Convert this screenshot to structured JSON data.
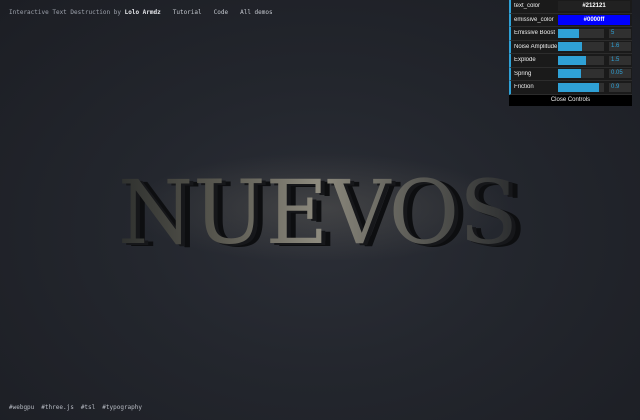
{
  "header": {
    "credit_prefix": "Interactive Text Destruction by",
    "credit_author": "Lolo Armdz",
    "links": [
      "Tutorial",
      "Code",
      "All demos"
    ]
  },
  "hero": {
    "text": "NUEVOS"
  },
  "footer": {
    "tags": [
      "#webgpu",
      "#three.js",
      "#tsl",
      "#typography"
    ]
  },
  "controls": {
    "text_color": {
      "label": "text_color",
      "value": "#212121"
    },
    "emissive_color": {
      "label": "emissive_color",
      "value": "#0000ff"
    },
    "sliders": [
      {
        "label": "Emissive Boost",
        "value": "5",
        "fill": 0.45
      },
      {
        "label": "Noise Amplitude",
        "value": "1.6",
        "fill": 0.53
      },
      {
        "label": "Explode",
        "value": "1.5",
        "fill": 0.6
      },
      {
        "label": "Spring",
        "value": "0.05",
        "fill": 0.5
      },
      {
        "label": "Friction",
        "value": "0.9",
        "fill": 0.9
      }
    ],
    "close_label": "Close Controls"
  },
  "colors": {
    "accent": "#2fa1d6",
    "panel_bg": "#1a1a1a",
    "text_color_swatch": "#212121",
    "emissive_swatch": "#0000ff"
  }
}
